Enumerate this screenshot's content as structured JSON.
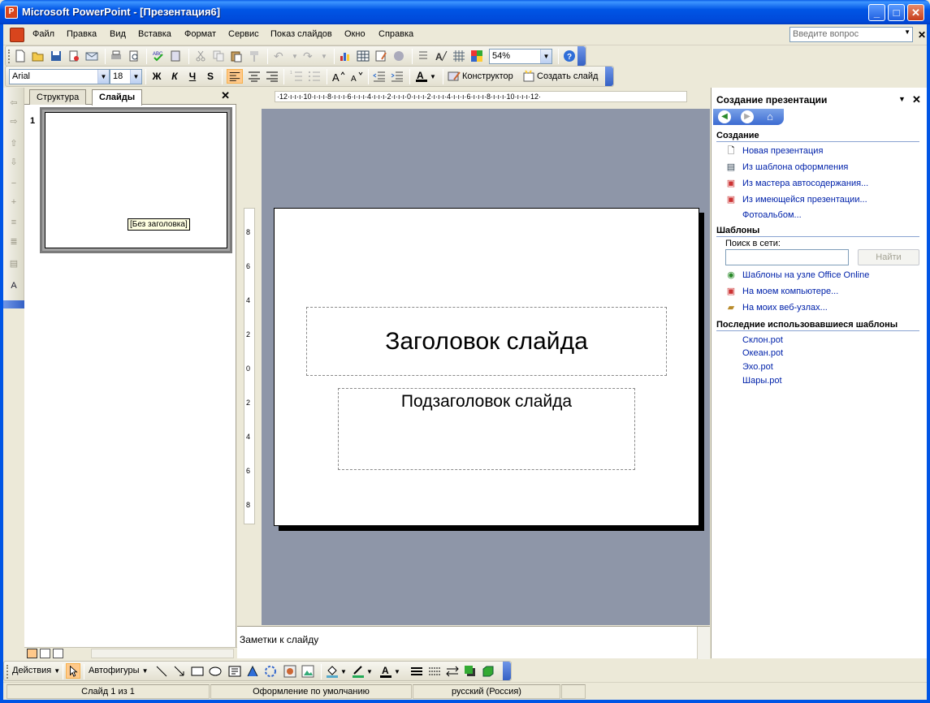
{
  "window": {
    "title": "Microsoft PowerPoint - [Презентация6]",
    "app_icon_letter": "P"
  },
  "menu": {
    "items": [
      "Файл",
      "Правка",
      "Вид",
      "Вставка",
      "Формат",
      "Сервис",
      "Показ слайдов",
      "Окно",
      "Справка"
    ],
    "ask_placeholder": "Введите вопрос"
  },
  "standard_toolbar": {
    "zoom": "54%"
  },
  "formatting_toolbar": {
    "font": "Arial",
    "size": "18",
    "bold": "Ж",
    "italic": "К",
    "underline": "Ч",
    "shadow": "S",
    "designer": "Конструктор",
    "new_slide": "Создать слайд"
  },
  "slides_pane": {
    "tabs": [
      "Структура",
      "Слайды"
    ],
    "active_tab": "Слайды",
    "slide_number": "1",
    "tooltip": "[Без заголовка]"
  },
  "ruler": {
    "h_text": "·12·ı·ı·ı·10·ı·ı·ı·8·ı·ı·ı·6·ı·ı·ı·4·ı·ı·ı·2·ı·ı·ı·0·ı·ı·ı·2·ı·ı·ı·4·ı·ı·ı·6·ı·ı·ı·8·ı·ı·ı·10·ı·ı·ı·12·",
    "v_labels": [
      "8",
      "6",
      "4",
      "2",
      "0",
      "2",
      "4",
      "6",
      "8"
    ]
  },
  "slide": {
    "title_placeholder": "Заголовок слайда",
    "subtitle_placeholder": "Подзаголовок слайда"
  },
  "notes": {
    "placeholder": "Заметки к слайду"
  },
  "task_pane": {
    "title": "Создание презентации",
    "sections": {
      "create": {
        "heading": "Создание",
        "links": [
          "Новая презентация",
          "Из шаблона оформления",
          "Из мастера автосодержания...",
          "Из имеющейся презентации...",
          "Фотоальбом..."
        ]
      },
      "templates": {
        "heading": "Шаблоны",
        "search_label": "Поиск в сети:",
        "find_button": "Найти",
        "links": [
          "Шаблоны на узле Office Online",
          "На моем компьютере...",
          "На моих веб-узлах..."
        ]
      },
      "recent": {
        "heading": "Последние использовавшиеся шаблоны",
        "links": [
          "Склон.pot",
          "Океан.pot",
          "Эхо.pot",
          "Шары.pot"
        ]
      }
    }
  },
  "drawing_toolbar": {
    "actions": "Действия",
    "autoshapes": "Автофигуры"
  },
  "status": {
    "slide": "Слайд 1 из 1",
    "design": "Оформление по умолчанию",
    "language": "русский (Россия)"
  },
  "colors": {
    "titlebar": "#0055e5",
    "canvas": "#8e96a8",
    "link": "#0022aa"
  }
}
